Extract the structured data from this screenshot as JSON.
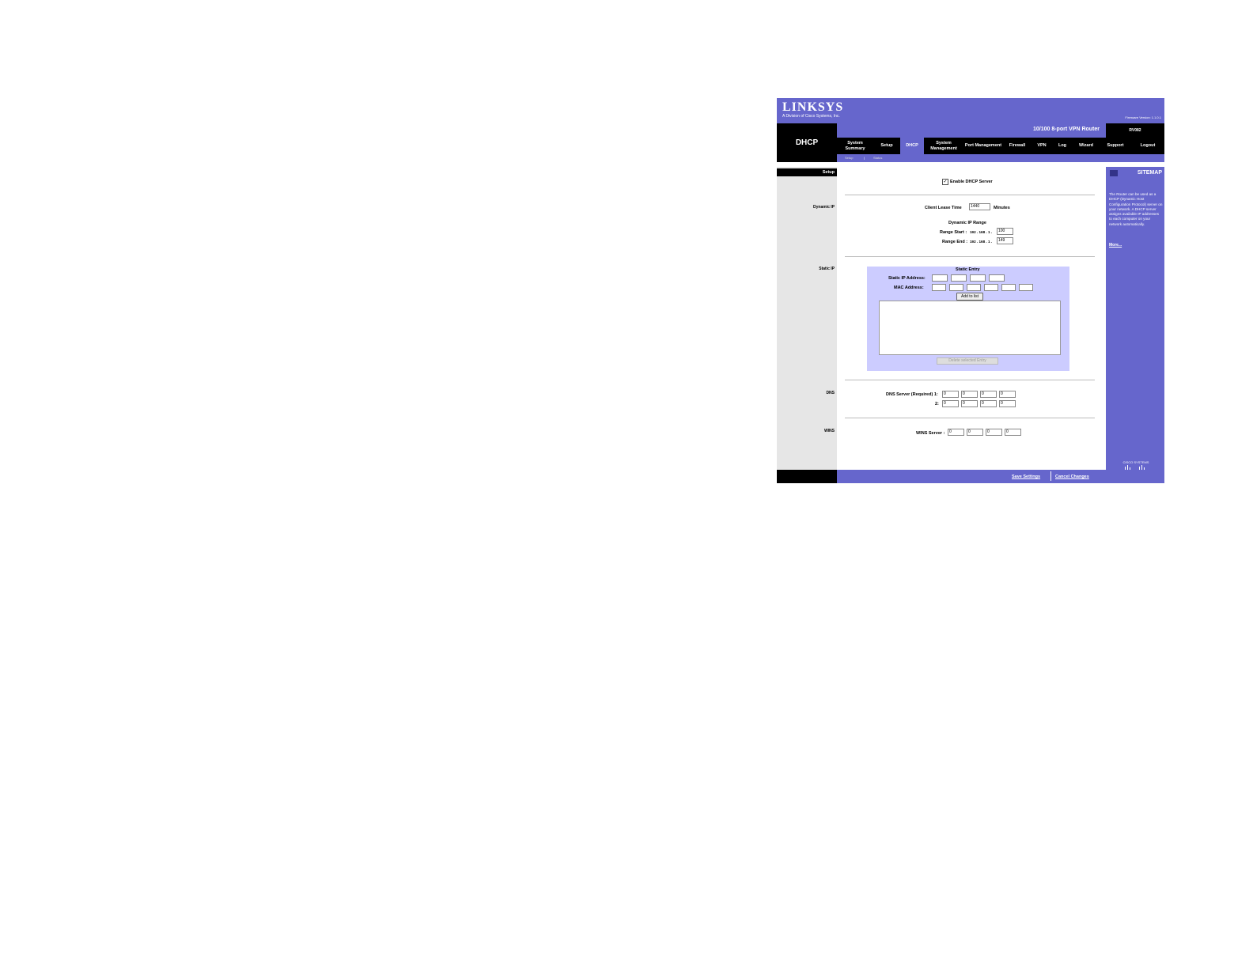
{
  "header": {
    "logo": "LINKSYS",
    "logo_sub": "A Division of Cisco Systems, Inc.",
    "firmware": "Firmware Version: 1.1.0.1",
    "product": "10/100 8-port VPN Router",
    "model": "RV082",
    "page_title": "DHCP"
  },
  "nav": [
    {
      "label": "System Summary"
    },
    {
      "label": "Setup"
    },
    {
      "label": "DHCP"
    },
    {
      "label": "System Management"
    },
    {
      "label": "Port Management"
    },
    {
      "label": "Firewall"
    },
    {
      "label": "VPN"
    },
    {
      "label": "Log"
    },
    {
      "label": "Wizard"
    },
    {
      "label": "Support"
    },
    {
      "label": "Logout"
    }
  ],
  "subnav": [
    "Setup",
    "Status"
  ],
  "sections": {
    "setup": "Setup",
    "dynamic_ip": "Dynamic IP",
    "static_ip": "Static IP",
    "dns": "DNS",
    "wins": "WINS"
  },
  "form": {
    "enable_dhcp": "Enable DHCP Server",
    "lease_label": "Client Lease Time",
    "lease_value": "1440",
    "lease_unit": "Minutes",
    "range_title": "Dynamic IP Range",
    "range_start_label": "Range Start :",
    "range_end_label": "Range End :",
    "ip_prefix": "192 .  168 .  1 .",
    "range_start": "100",
    "range_end": "149",
    "static_title": "Static Entry",
    "static_ip_label": "Static IP Address:",
    "mac_label": "MAC Address:",
    "add_button": "Add to list",
    "delete_button": "Delete selected Entry",
    "dns1_label": "DNS Server (Required) 1:",
    "dns2_label": "2:",
    "dns1": [
      "0",
      "0",
      "0",
      "0"
    ],
    "dns2": [
      "0",
      "0",
      "0",
      "0"
    ],
    "wins_label": "WINS Server :",
    "wins": [
      "0",
      "0",
      "0",
      "0"
    ]
  },
  "sitemap": {
    "title": "SITEMAP",
    "help": "The Router can be used as a DHCP (Dynamic Host Configuration Protocol) server on your network. A DHCP server assigns available IP addresses to each computer on your network automatically.",
    "more": "More..."
  },
  "footer": {
    "save": "Save Settings",
    "cancel": "Cancel Changes",
    "cisco": "CISCO SYSTEMS"
  },
  "colors": {
    "brand": "#6666cc",
    "panel": "#ccccff"
  }
}
